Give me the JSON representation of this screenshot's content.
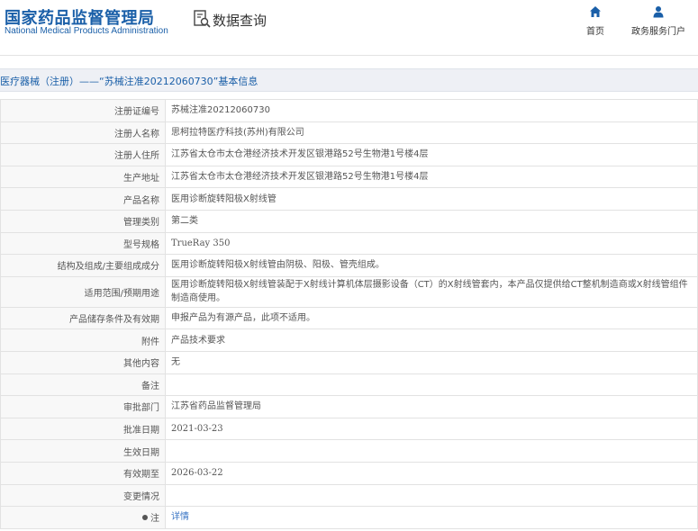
{
  "header": {
    "logo_cn": "国家药品监督管理局",
    "logo_en": "National Medical Products Administration",
    "query_label": "数据查询",
    "nav": {
      "home_label": "首页",
      "service_label": "政务服务门户"
    }
  },
  "title_bar": {
    "text": "医疗器械（注册）——“苏械注准20212060730”基本信息"
  },
  "rows": [
    {
      "key": "注册证编号",
      "value": "苏械注准20212060730"
    },
    {
      "key": "注册人名称",
      "value": "思柯拉特医疗科技(苏州)有限公司"
    },
    {
      "key": "注册人住所",
      "value": "江苏省太仓市太仓港经济技术开发区银港路52号生物港1号楼4层"
    },
    {
      "key": "生产地址",
      "value": "江苏省太仓市太仓港经济技术开发区银港路52号生物港1号楼4层"
    },
    {
      "key": "产品名称",
      "value": "医用诊断旋转阳极X射线管"
    },
    {
      "key": "管理类别",
      "value": "第二类"
    },
    {
      "key": "型号规格",
      "value": "TrueRay 350"
    },
    {
      "key": "结构及组成/主要组成成分",
      "value": "医用诊断旋转阳极X射线管由阴极、阳极、管壳组成。"
    },
    {
      "key": "适用范围/预期用途",
      "value": "医用诊断旋转阳极X射线管装配于X射线计算机体层摄影设备（CT）的X射线管套内，本产品仅提供给CT整机制造商或X射线管组件制造商使用。"
    },
    {
      "key": "产品储存条件及有效期",
      "value": "申报产品为有源产品，此项不适用。"
    },
    {
      "key": "附件",
      "value": "产品技术要求"
    },
    {
      "key": "其他内容",
      "value": "无"
    },
    {
      "key": "备注",
      "value": ""
    },
    {
      "key": "审批部门",
      "value": "江苏省药品监督管理局"
    },
    {
      "key": "批准日期",
      "value": "2021-03-23"
    },
    {
      "key": "生效日期",
      "value": ""
    },
    {
      "key": "有效期至",
      "value": "2026-03-22"
    },
    {
      "key": "变更情况",
      "value": ""
    }
  ],
  "note": {
    "key": "注",
    "link": "详情"
  },
  "colors": {
    "brand": "#1a5fa8",
    "link": "#3a75c4",
    "title_bg": "#eef0f5",
    "key_bg": "#f8f8f8",
    "border": "#e2e2e2"
  }
}
